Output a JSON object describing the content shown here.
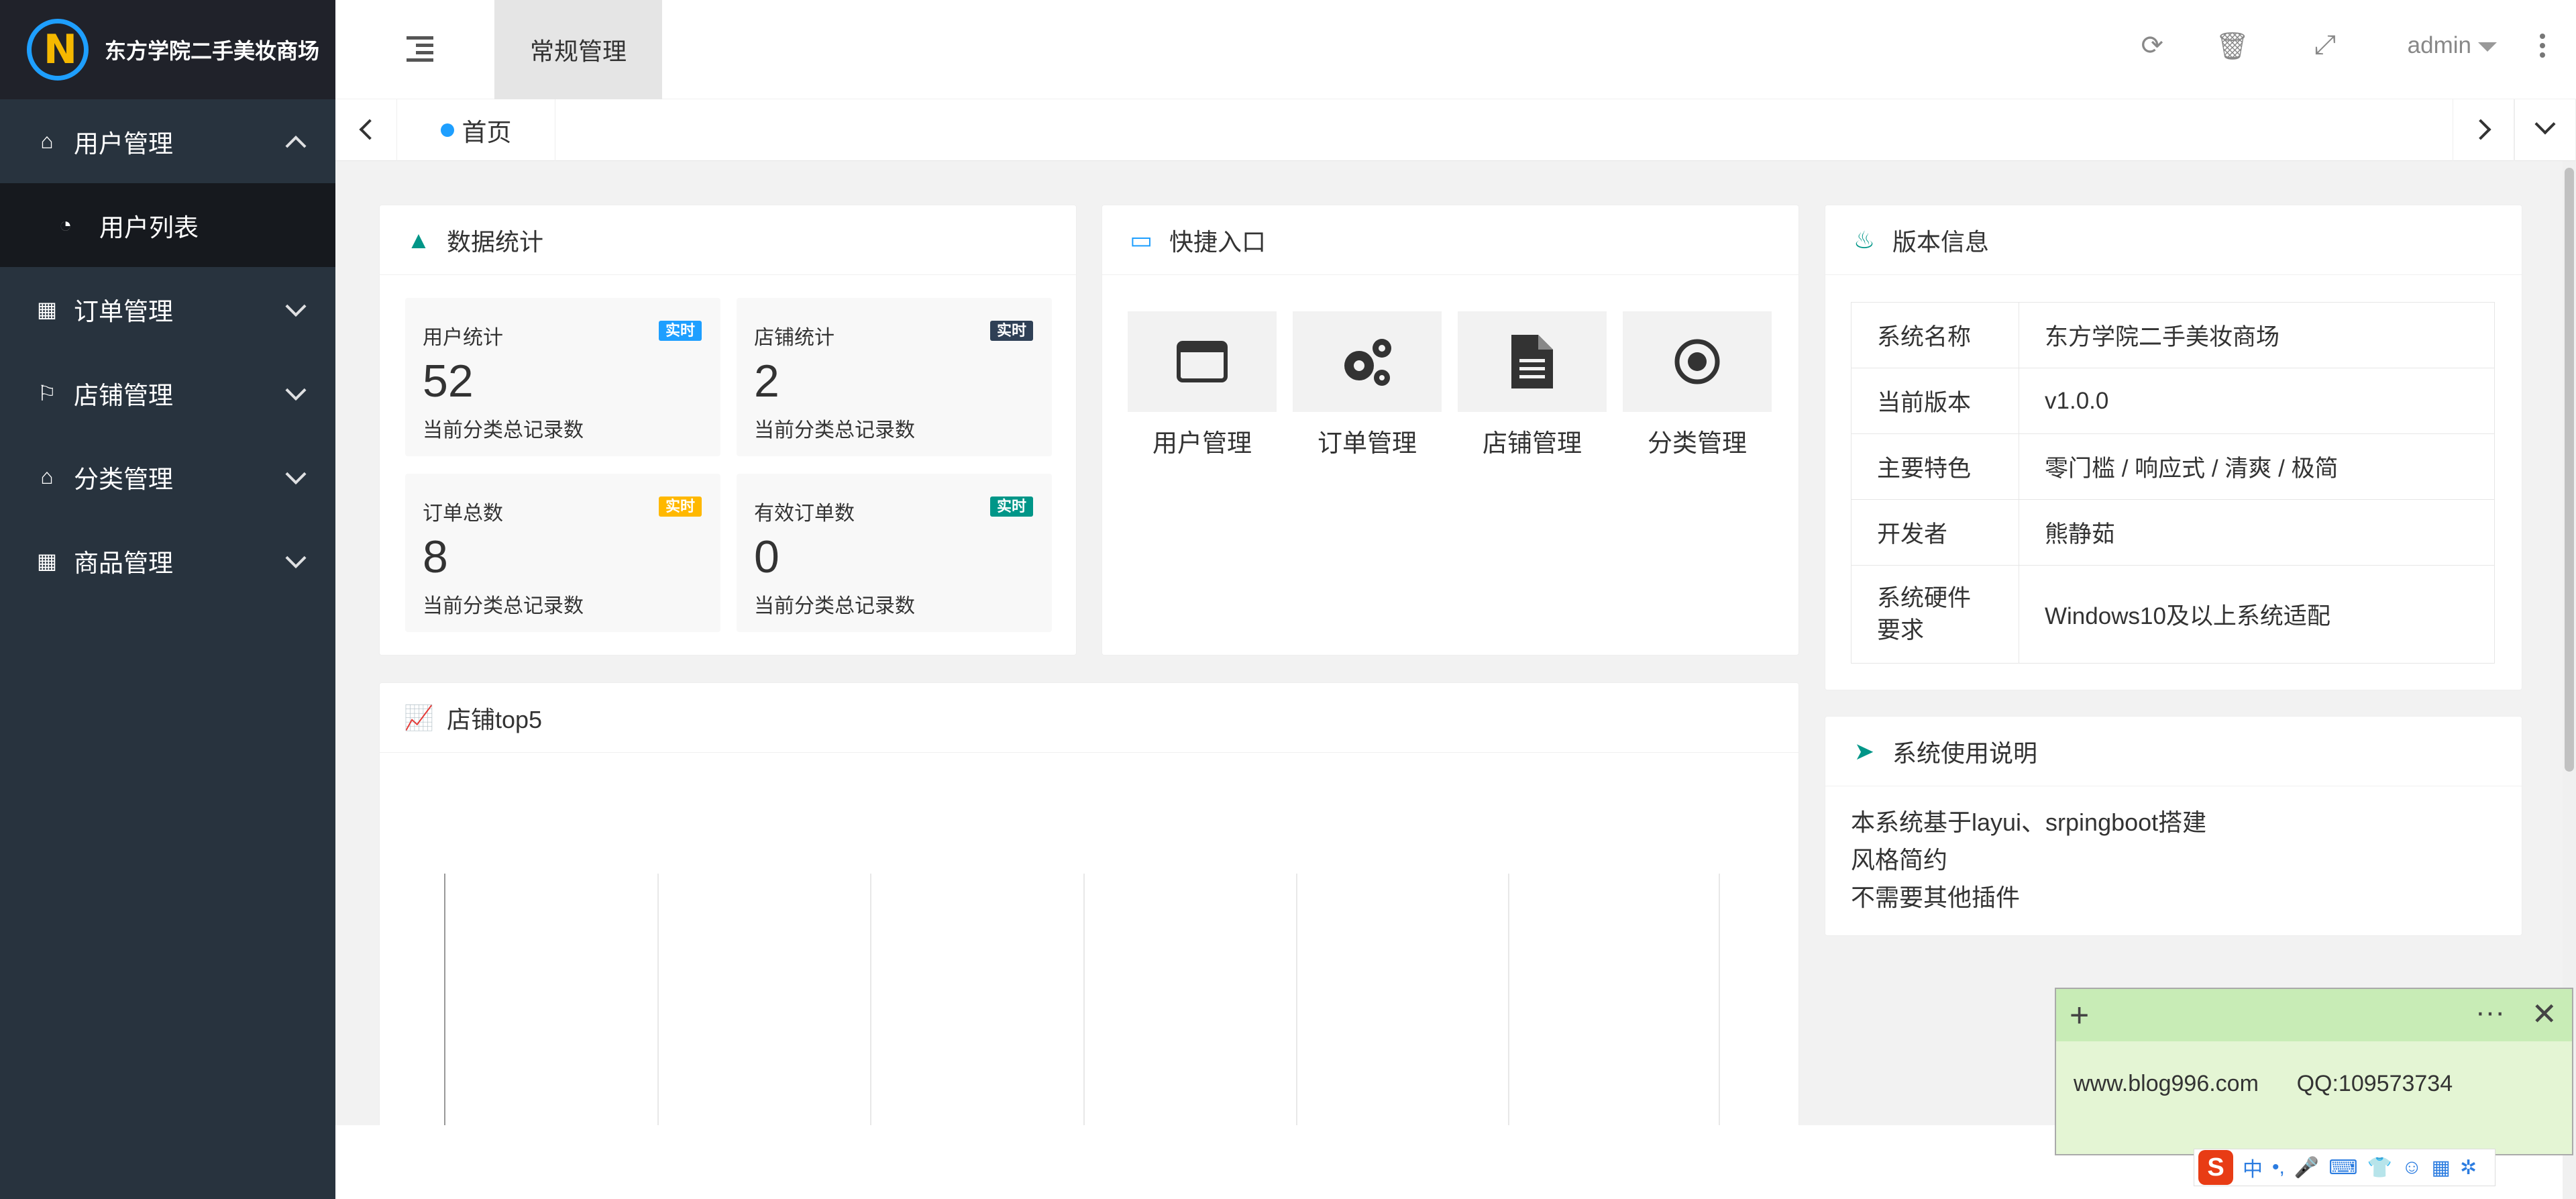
{
  "app": {
    "title": "东方学院二手美妆商场",
    "logo_glyph": "N"
  },
  "sidebar": {
    "items": [
      {
        "label": "用户管理",
        "icon": "home-icon",
        "expanded": true,
        "children": [
          {
            "label": "用户列表",
            "icon": "dashboard-icon"
          }
        ]
      },
      {
        "label": "订单管理",
        "icon": "calendar-icon"
      },
      {
        "label": "店铺管理",
        "icon": "flag-icon"
      },
      {
        "label": "分类管理",
        "icon": "home-icon"
      },
      {
        "label": "商品管理",
        "icon": "calendar-icon"
      }
    ]
  },
  "header": {
    "active_tab": "常规管理",
    "user": "admin"
  },
  "tabs": {
    "home": "首页"
  },
  "stats_card": {
    "title": "数据统计",
    "items": [
      {
        "title": "用户统计",
        "value": "52",
        "sub": "当前分类总记录数",
        "badge": "实时",
        "badge_color": "#1e9fff"
      },
      {
        "title": "店铺统计",
        "value": "2",
        "sub": "当前分类总记录数",
        "badge": "实时",
        "badge_color": "#2f4056"
      },
      {
        "title": "订单总数",
        "value": "8",
        "sub": "当前分类总记录数",
        "badge": "实时",
        "badge_color": "#ffb800"
      },
      {
        "title": "有效订单数",
        "value": "0",
        "sub": "当前分类总记录数",
        "badge": "实时",
        "badge_color": "#009688"
      }
    ]
  },
  "quick_card": {
    "title": "快捷入口",
    "items": [
      {
        "label": "用户管理",
        "icon": "window-icon"
      },
      {
        "label": "订单管理",
        "icon": "gears-icon"
      },
      {
        "label": "店铺管理",
        "icon": "document-icon"
      },
      {
        "label": "分类管理",
        "icon": "target-icon"
      }
    ]
  },
  "version_card": {
    "title": "版本信息",
    "rows": [
      {
        "key": "系统名称",
        "value": "东方学院二手美妆商场"
      },
      {
        "key": "当前版本",
        "value": "v1.0.0"
      },
      {
        "key": "主要特色",
        "value": "零门槛 / 响应式 / 清爽 / 极简"
      },
      {
        "key": "开发者",
        "value": "熊静茹"
      },
      {
        "key": "系统硬件要求",
        "value": "Windows10及以上系统适配"
      }
    ]
  },
  "chart_card": {
    "title": "店铺top5"
  },
  "usage_card": {
    "title": "系统使用说明",
    "lines": [
      "本系统基于layui、srpingboot搭建",
      "风格简约",
      "不需要其他插件"
    ]
  },
  "note": {
    "text": "www.blog996.com      QQ:109573734"
  },
  "ime": {
    "logo": "S",
    "mode": "中"
  },
  "colors": {
    "sidebar": "#28333e",
    "logo_bg": "#20222a",
    "accent": "#1e9fff",
    "teal": "#009688"
  }
}
